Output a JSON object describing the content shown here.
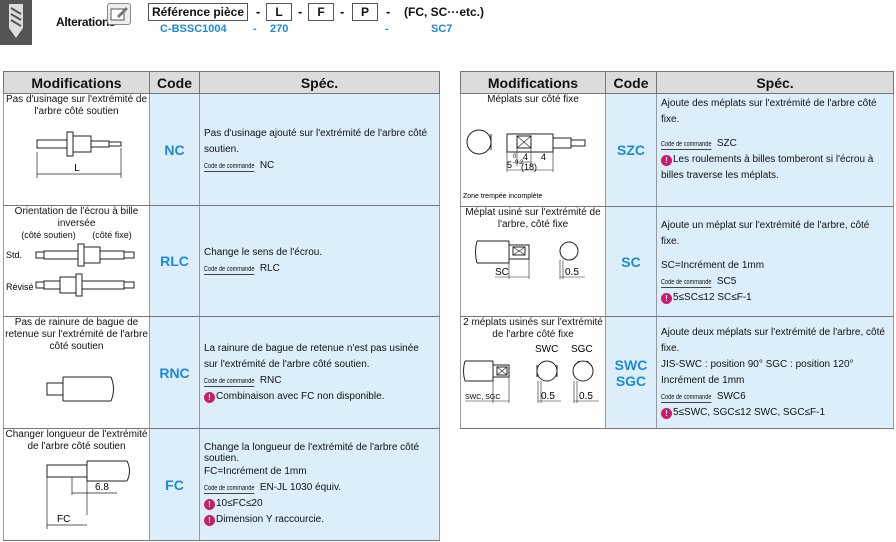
{
  "header": {
    "title": "Alterations",
    "fields": [
      "Référence pièce",
      "L",
      "F",
      "P"
    ],
    "separator": "-",
    "suffix": "(FC, SC···etc.)",
    "example": [
      "C-BSSC1004",
      "-",
      "270",
      "-",
      "SC7"
    ]
  },
  "columns": {
    "modifications": "Modifications",
    "code": "Code",
    "spec": "Spéc."
  },
  "code_label": "Code de commande",
  "left_rows": [
    {
      "mod": "Pas d'usinage sur l'extrémité de l'arbre côté soutien",
      "code": "NC",
      "spec_lines": [
        "Pas d'usinage ajouté sur l'extrémité de l'arbre côté soutien."
      ],
      "order": "NC",
      "fig": {
        "dim": "L"
      }
    },
    {
      "mod": "Orientation de l'écrou à bille inversée",
      "sub": [
        "(côté soutien)",
        "(côté fixe)"
      ],
      "labels": [
        "Std.",
        "Révisé"
      ],
      "code": "RLC",
      "spec_lines": [
        "Change le sens de l'écrou."
      ],
      "order": "RLC"
    },
    {
      "mod": "Pas de rainure de bague de retenue sur l'extrémité de l'arbre côté soutien",
      "code": "RNC",
      "spec_lines": [
        "La rainure de bague de retenue n'est pas usinée sur l'extrémité de l'arbre côté soutien."
      ],
      "order": "RNC",
      "note": "Combinaison avec FC non disponible."
    },
    {
      "mod": "Changer longueur de l'extrémité de l'arbre côté soutien",
      "code": "FC",
      "spec_lines": [
        "Change la longueur de l'extrémité de l'arbre côté soutien.",
        "FC=Incrément de 1mm"
      ],
      "order": "EN-JL 1030 équiv.",
      "notes": [
        "10≤FC≤20",
        "Dimension Y raccourcie."
      ],
      "fig": {
        "dim1": "6.8",
        "dim2": "FC"
      }
    }
  ],
  "right_rows": [
    {
      "mod": "Méplats sur côté fixe",
      "code": "SZC",
      "spec_lines": [
        "Ajoute des méplats sur l'extrémité de l'arbre côté fixe."
      ],
      "order": "SZC",
      "note": "Les roulements à billes tomberont si l'écrou à billes traverse les méplats.",
      "fig": {
        "d1": "4",
        "d2": "4",
        "d3": "5",
        "d4": "-0.2",
        "d5": "0",
        "d6": "(18)",
        "caption": "Zone trempée incomplète"
      }
    },
    {
      "mod": "Méplat usiné sur l'extrémité de l'arbre, côté fixe",
      "code": "SC",
      "spec_lines": [
        "Ajoute un méplat sur l'extrémité de l'arbre, côté fixe.",
        "SC=Incrément de 1mm"
      ],
      "order": "SC5",
      "note": "5≤SC≤12  SC≤F-1",
      "fig": {
        "dim1": "SC",
        "dim2": "0.5"
      }
    },
    {
      "mod": "2 méplats usinés sur l'extrémité de l'arbre côté fixe",
      "code": "SWC",
      "code2": "SGC",
      "spec_lines": [
        "Ajoute deux méplats sur l'extrémité de l'arbre, côté fixe.",
        "JIS-SWC : position 90°  SGC : position 120°",
        "Incrément de 1mm"
      ],
      "order": "SWC6",
      "note": "5≤SWC, SGC≤12  SWC, SGC≤F-1",
      "fig": {
        "l1": "SWC",
        "l2": "SGC",
        "l3": "SWC, SGC",
        "d1": "0.5",
        "d2": "0.5"
      }
    }
  ]
}
